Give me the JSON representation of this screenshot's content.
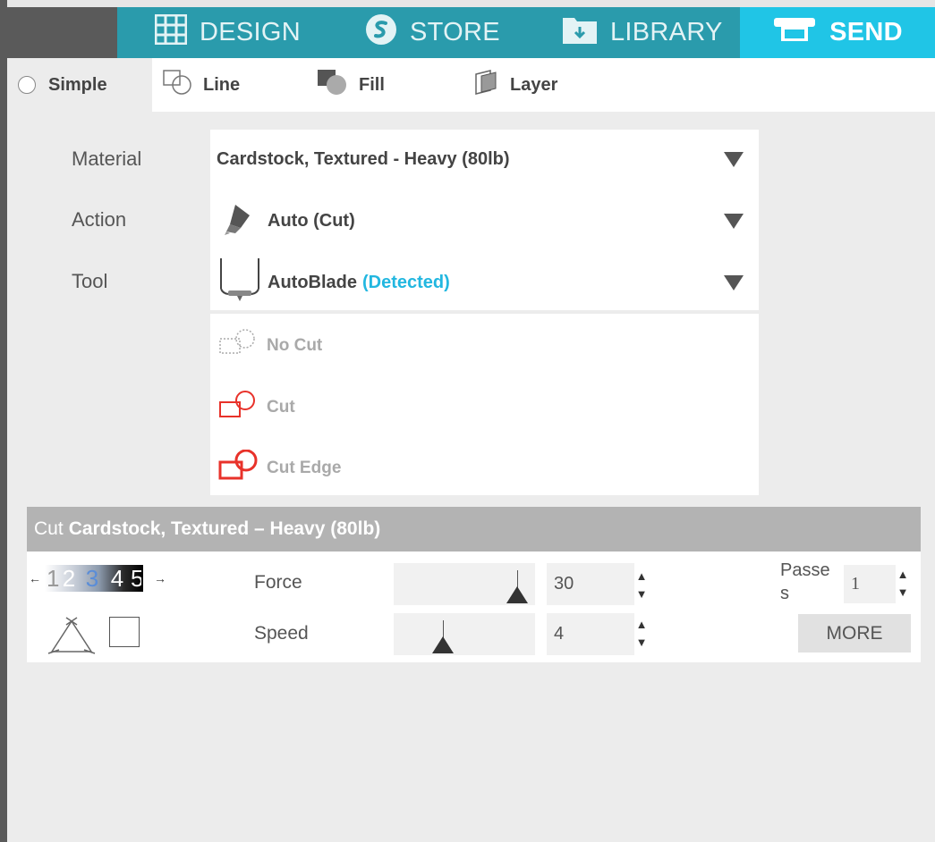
{
  "nav": {
    "tabs": [
      {
        "label": "DESIGN",
        "icon": "grid-icon"
      },
      {
        "label": "STORE",
        "icon": "store-icon"
      },
      {
        "label": "LIBRARY",
        "icon": "library-folder-icon"
      },
      {
        "label": "SEND",
        "icon": "send-machine-icon",
        "active": true
      }
    ]
  },
  "subtabs": {
    "simple": "Simple",
    "line": "Line",
    "fill": "Fill",
    "layer": "Layer"
  },
  "labels": {
    "material": "Material",
    "action": "Action",
    "tool": "Tool"
  },
  "material": {
    "value": "Cardstock, Textured - Heavy (80lb)"
  },
  "action": {
    "value": "Auto (Cut)"
  },
  "tool": {
    "value": "AutoBlade",
    "status": "(Detected)"
  },
  "cut_options": [
    {
      "label": "No Cut",
      "icon": "no-cut-icon"
    },
    {
      "label": "Cut",
      "icon": "cut-icon"
    },
    {
      "label": "Cut Edge",
      "icon": "cut-edge-icon"
    }
  ],
  "cut_header": {
    "prefix": "Cut",
    "material": "Cardstock, Textured – Heavy (80lb)"
  },
  "blade_sequence": [
    "1",
    "2",
    "3",
    "4",
    "5"
  ],
  "settings": {
    "force_label": "Force",
    "force_value": "30",
    "speed_label": "Speed",
    "speed_value": "4",
    "passes_label_1": "Passe",
    "passes_label_2": "s",
    "passes_value": "1",
    "more_label": "MORE"
  },
  "colors": {
    "nav_bg": "#2a9bac",
    "send_active": "#20c5e6",
    "detected": "#22b7e0",
    "cut_red": "#e8322a"
  }
}
